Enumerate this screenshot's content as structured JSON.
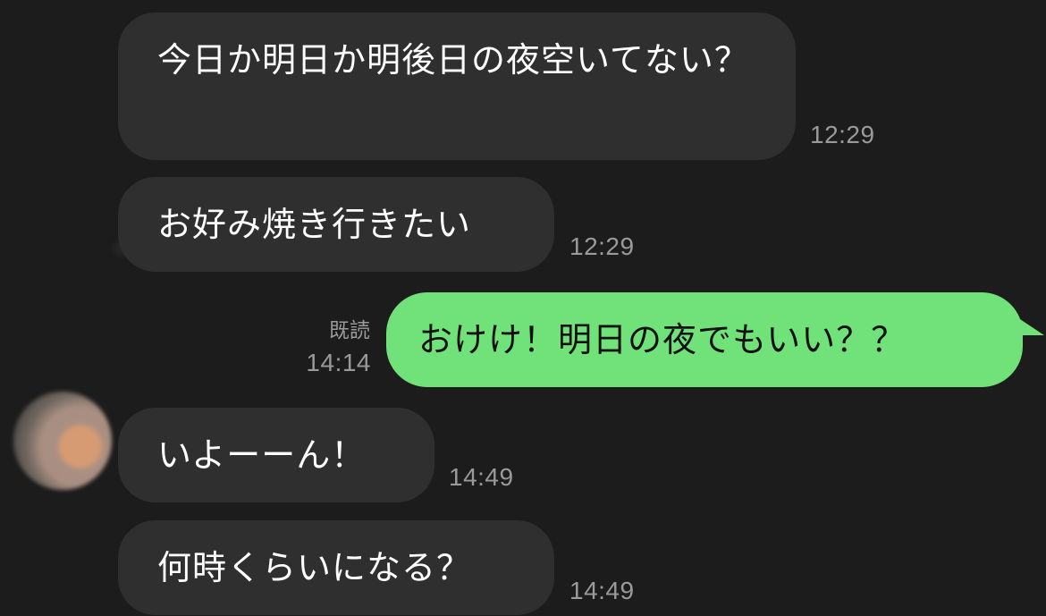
{
  "messages": [
    {
      "id": "m1",
      "direction": "incoming",
      "text": "今日か明日か明後日の夜空いてない？",
      "time": "12:29"
    },
    {
      "id": "m2",
      "direction": "incoming",
      "text": "お好み焼き行きたい",
      "time": "12:29"
    },
    {
      "id": "m3",
      "direction": "outgoing",
      "text": "おけけ！明日の夜でもいい？？",
      "read_label": "既読",
      "time": "14:14"
    },
    {
      "id": "m4",
      "direction": "incoming",
      "text": "いよーーん！",
      "time": "14:49"
    },
    {
      "id": "m5",
      "direction": "incoming",
      "text": "何時くらいになる？",
      "time": "14:49"
    }
  ],
  "colors": {
    "background": "#1c1c1c",
    "incoming_bubble": "#2f2f2f",
    "outgoing_bubble": "#71e27a",
    "timestamp": "#9a9a9a"
  },
  "icons": {
    "avatar": "blurred-profile-avatar"
  }
}
